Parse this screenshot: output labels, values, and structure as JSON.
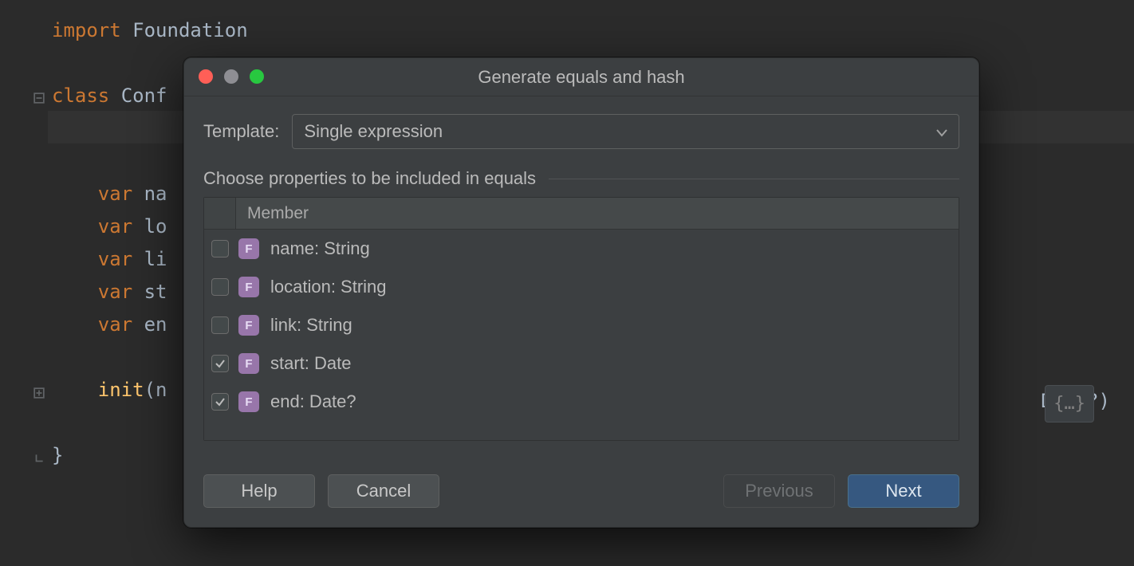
{
  "editor": {
    "line1_kw": "import",
    "line1_rest": " Foundation",
    "line3_kw": "class",
    "line3_rest": " Conf",
    "vars": [
      "na",
      "lo",
      "li",
      "st",
      "en"
    ],
    "var_kw": "var",
    "init_kw": "init",
    "init_paren": "(n",
    "init_tail": "Date?) ",
    "fold_right": "{…}",
    "close_brace": "}"
  },
  "dialog": {
    "title": "Generate equals and hash",
    "template_label": "Template:",
    "template_value": "Single expression",
    "section_label": "Choose properties to be included in equals",
    "member_header": "Member",
    "members": [
      {
        "label": "name: String",
        "checked": false
      },
      {
        "label": "location: String",
        "checked": false
      },
      {
        "label": "link: String",
        "checked": false
      },
      {
        "label": "start: Date",
        "checked": true
      },
      {
        "label": "end: Date?",
        "checked": true
      }
    ],
    "buttons": {
      "help": "Help",
      "cancel": "Cancel",
      "previous": "Previous",
      "next": "Next"
    }
  }
}
